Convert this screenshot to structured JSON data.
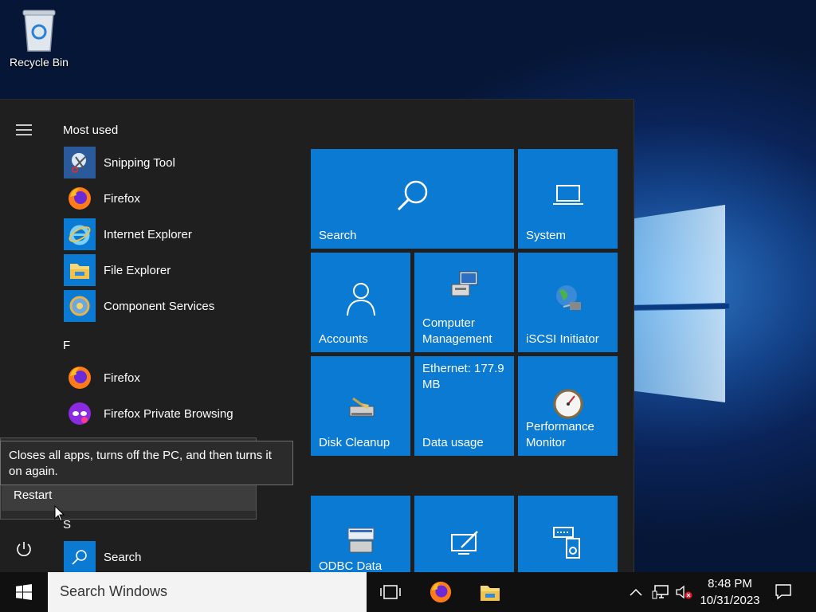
{
  "desktop": {
    "recycle_bin_label": "Recycle Bin"
  },
  "start_menu": {
    "most_used_header": "Most used",
    "most_used": [
      "Snipping Tool",
      "Firefox",
      "Internet Explorer",
      "File Explorer",
      "Component Services"
    ],
    "letter_f": "F",
    "f_apps": [
      "Firefox",
      "Firefox Private Browsing"
    ],
    "letter_s": "S",
    "s_apps": [
      "Search"
    ],
    "tiles": {
      "search": "Search",
      "system": "System",
      "accounts": "Accounts",
      "computer_management": "Computer Management",
      "iscsi": "iSCSI Initiator",
      "disk_cleanup": "Disk Cleanup",
      "data_usage_value": "Ethernet: 177.9 MB",
      "data_usage": "Data usage",
      "perfmon": "Performance Monitor",
      "odbc": "ODBC Data"
    },
    "power_menu": {
      "restart": "Restart"
    },
    "tooltip": "Closes all apps, turns off the PC, and then turns it on again."
  },
  "taskbar": {
    "search_placeholder": "Search Windows",
    "time": "8:48 PM",
    "date": "10/31/2023"
  },
  "colors": {
    "tile": "#0a7ad3",
    "start_bg": "#1f1f1f",
    "taskbar": "#101010"
  },
  "icons": [
    "recycle-bin-icon",
    "hamburger-icon",
    "power-icon",
    "snipping-tool-icon",
    "firefox-icon",
    "internet-explorer-icon",
    "file-explorer-icon",
    "component-services-icon",
    "firefox-private-icon",
    "search-icon",
    "laptop-icon",
    "person-icon",
    "computer-management-icon",
    "globe-icon",
    "disk-cleanup-icon",
    "gauge-icon",
    "odbc-icon",
    "pen-monitor-icon",
    "keyboard-speaker-icon",
    "windows-logo-icon",
    "task-view-icon",
    "chevron-up-icon",
    "network-icon",
    "volume-muted-icon",
    "notification-icon"
  ]
}
